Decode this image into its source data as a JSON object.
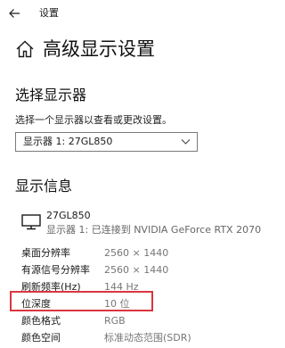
{
  "titlebar": {
    "title": "设置",
    "back_icon": "back-arrow-icon"
  },
  "page": {
    "title": "高级显示设置",
    "icon": "home-icon"
  },
  "select_display": {
    "heading": "选择显示器",
    "description": "选择一个显示器以查看或更改设置。",
    "selected": "显示器 1: 27GL850",
    "chevron_icon": "chevron-down-icon"
  },
  "display_info": {
    "heading": "显示信息",
    "monitor_icon": "monitor-icon",
    "monitor_name": "27GL850",
    "monitor_connection": "显示器 1: 已连接到 NVIDIA GeForce RTX 2070",
    "rows": [
      {
        "label": "桌面分辨率",
        "value": "2560 × 1440"
      },
      {
        "label": "有源信号分辨率",
        "value": "2560 × 1440"
      },
      {
        "label": "刷新频率(Hz)",
        "value": "144 Hz"
      },
      {
        "label": "位深度",
        "value": "10 位"
      },
      {
        "label": "颜色格式",
        "value": "RGB"
      },
      {
        "label": "颜色空间",
        "value": "标准动态范围(SDR)"
      }
    ],
    "highlight_color": "#d9363e"
  }
}
